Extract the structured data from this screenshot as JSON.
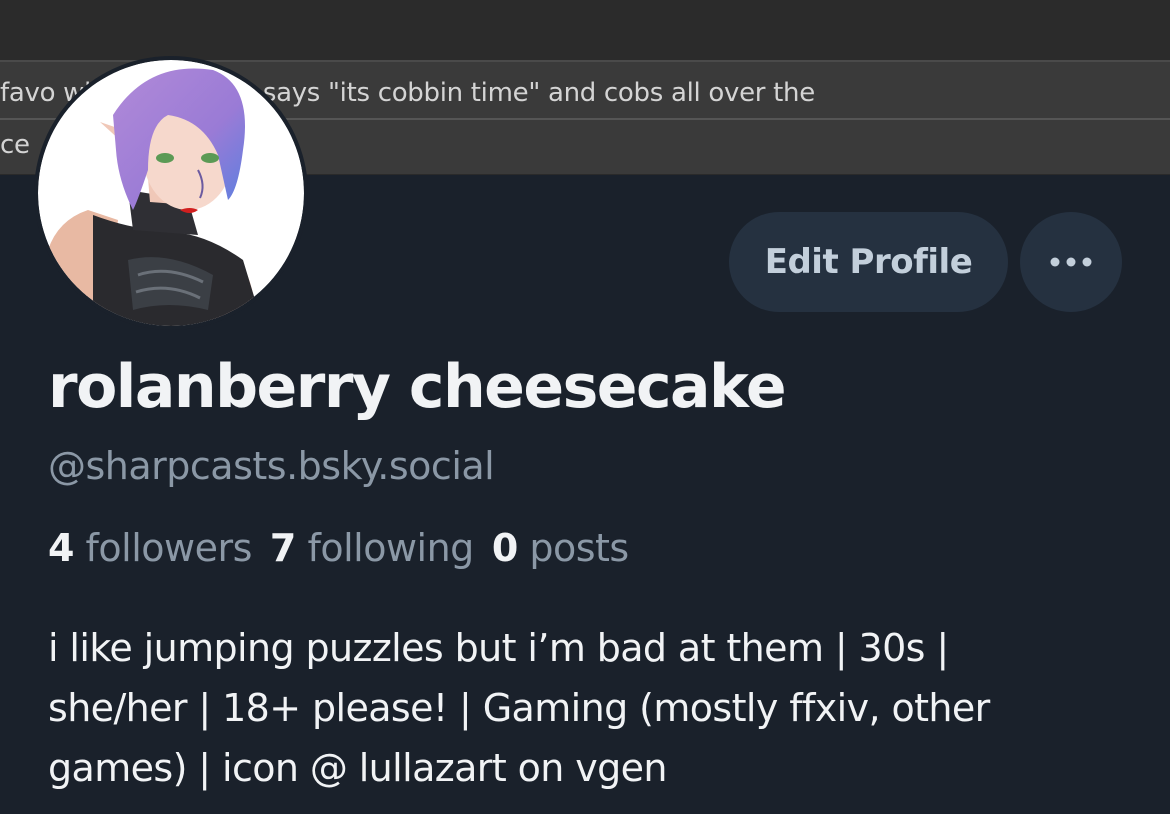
{
  "banner": {
    "line1": " favo           when bahamut says \"its cobbin time\" and cobs all over the",
    "line2": "ce"
  },
  "profile": {
    "avatar_icon": "avatar-illustration",
    "display_name": "rolanberry cheesecake",
    "handle": "@sharpcasts.bsky.social",
    "bio_lines": [
      "i like jumping puzzles but i’m bad at them | 30s |",
      "she/her | 18+ please! | Gaming (mostly ffxiv, other",
      "games) | icon @ lullazart on vgen"
    ]
  },
  "actions": {
    "edit_profile_label": "Edit Profile",
    "more_icon": "more-horizontal-icon"
  },
  "stats": {
    "followers_count": "4",
    "followers_label": "followers",
    "following_count": "7",
    "following_label": "following",
    "posts_count": "0",
    "posts_label": "posts"
  },
  "colors": {
    "background": "#1a212b",
    "button_bg": "#253140",
    "muted_text": "#8b98a6",
    "primary_text": "#f1f3f5"
  }
}
